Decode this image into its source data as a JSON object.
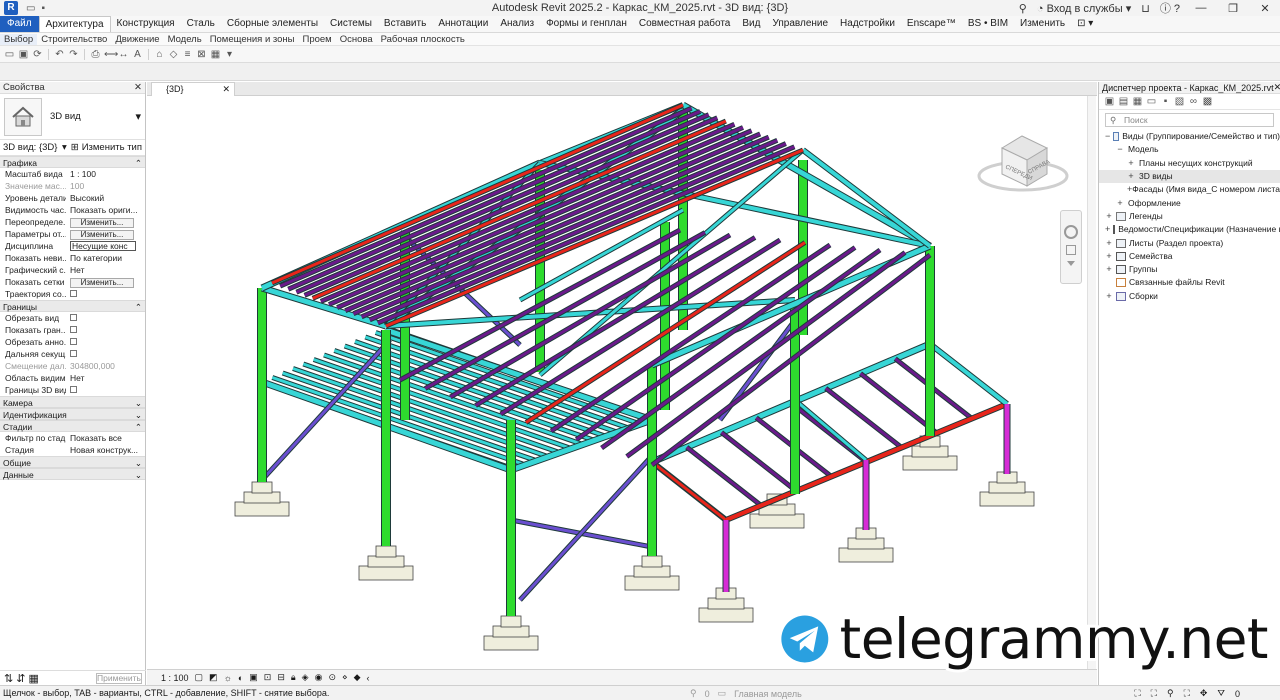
{
  "window": {
    "app_logo": "R",
    "title": "Autodesk Revit 2025.2 - Каркас_КМ_2025.rvt - 3D вид: {3D}",
    "sign_in": "Вход в службы",
    "help": "?"
  },
  "ribbon": {
    "tabs": [
      "Файл",
      "Архитектура",
      "Конструкция",
      "Сталь",
      "Сборные элементы",
      "Системы",
      "Вставить",
      "Аннотации",
      "Анализ",
      "Формы и генплан",
      "Совместная работа",
      "Вид",
      "Управление",
      "Надстройки",
      "Enscape™",
      "BS • BIM",
      "Изменить"
    ],
    "active_tab": "Архитектура",
    "panels": [
      "Выбор",
      "Строительство",
      "Движение",
      "Модель",
      "Помещения и зоны",
      "Проем",
      "Основа",
      "Рабочая плоскость"
    ]
  },
  "properties": {
    "title": "Свойства",
    "type_name": "3D вид",
    "instance_selector": "3D вид: {3D}",
    "edit_type": "Изменить тип",
    "groups": [
      {
        "name": "Графика",
        "rows": [
          {
            "key": "Масштаб вида",
            "value": "1 : 100",
            "kind": "text"
          },
          {
            "key": "Значение мас...",
            "value": "100",
            "kind": "grey"
          },
          {
            "key": "Уровень детали...",
            "value": "Высокий",
            "kind": "text"
          },
          {
            "key": "Видимость час...",
            "value": "Показать ориги...",
            "kind": "text"
          },
          {
            "key": "Переопределе...",
            "value": "Изменить...",
            "kind": "button"
          },
          {
            "key": "Параметры от...",
            "value": "Изменить...",
            "kind": "button"
          },
          {
            "key": "Дисциплина",
            "value": "Несущие конс",
            "kind": "boxed"
          },
          {
            "key": "Показать неви...",
            "value": "По категории",
            "kind": "text"
          },
          {
            "key": "Графический с...",
            "value": "Нет",
            "kind": "text"
          },
          {
            "key": "Показать сетки",
            "value": "Изменить...",
            "kind": "button"
          },
          {
            "key": "Траектория со...",
            "value": "",
            "kind": "check"
          }
        ]
      },
      {
        "name": "Границы",
        "rows": [
          {
            "key": "Обрезать вид",
            "value": "",
            "kind": "check"
          },
          {
            "key": "Показать гран...",
            "value": "",
            "kind": "check"
          },
          {
            "key": "Обрезать анно...",
            "value": "",
            "kind": "check"
          },
          {
            "key": "Дальняя секущ...",
            "value": "",
            "kind": "check"
          },
          {
            "key": "Смещение дал...",
            "value": "304800,000",
            "kind": "grey"
          },
          {
            "key": "Область видим...",
            "value": "Нет",
            "kind": "text"
          },
          {
            "key": "Границы 3D вида",
            "value": "",
            "kind": "check"
          }
        ]
      },
      {
        "name": "Камера",
        "rows": []
      },
      {
        "name": "Идентификация",
        "rows": []
      },
      {
        "name": "Стадии",
        "rows": [
          {
            "key": "Фильтр по стад...",
            "value": "Показать все",
            "kind": "text"
          },
          {
            "key": "Стадия",
            "value": "Новая конструк...",
            "kind": "text"
          }
        ]
      },
      {
        "name": "Общие",
        "rows": []
      },
      {
        "name": "Данные",
        "rows": []
      }
    ],
    "apply": "Применить"
  },
  "view": {
    "tab_label": "{3D}",
    "scale": "1 : 100",
    "viewcube_labels": [
      "СПЕРЕДИ",
      "СПРАВА"
    ]
  },
  "browser": {
    "title": "Диспетчер проекта - Каркас_КМ_2025.rvt",
    "search_placeholder": "Поиск",
    "tree": [
      {
        "level": 0,
        "twisty": "−",
        "icon": "views",
        "label": "Виды (Группирование/Семейство и тип)"
      },
      {
        "level": 1,
        "twisty": "−",
        "icon": "",
        "label": "Модель"
      },
      {
        "level": 2,
        "twisty": "+",
        "icon": "",
        "label": "Планы несущих конструкций"
      },
      {
        "level": 2,
        "twisty": "+",
        "icon": "",
        "label": "3D виды",
        "selected": true
      },
      {
        "level": 2,
        "twisty": "+",
        "icon": "",
        "label": "Фасады (Имя вида_С номером листа)"
      },
      {
        "level": 1,
        "twisty": "+",
        "icon": "",
        "label": "Оформление"
      },
      {
        "level": 0,
        "twisty": "+",
        "icon": "legend",
        "label": "Легенды"
      },
      {
        "level": 0,
        "twisty": "+",
        "icon": "schedule",
        "label": "Ведомости/Спецификации (Назначение в"
      },
      {
        "level": 0,
        "twisty": "+",
        "icon": "sheet",
        "label": "Листы (Раздел проекта)"
      },
      {
        "level": 0,
        "twisty": "+",
        "icon": "family",
        "label": "Семейства"
      },
      {
        "level": 0,
        "twisty": "+",
        "icon": "group",
        "label": "Группы"
      },
      {
        "level": 0,
        "twisty": "",
        "icon": "link",
        "label": "Связанные файлы Revit"
      },
      {
        "level": 0,
        "twisty": "+",
        "icon": "assembly",
        "label": "Сборки"
      }
    ]
  },
  "status": {
    "hint": "Щелчок - выбор, TAB - варианты, CTRL - добавление, SHIFT - снятие выбора.",
    "counter": "0",
    "model": "Главная модель",
    "filter_count": "0"
  },
  "watermark": {
    "text": "telegrammy.net"
  },
  "colors": {
    "column": "#2edb2e",
    "beam": "#37d6d6",
    "purlin": "#6a1a8a",
    "ridge": "#e8251b",
    "brace": "#6a4fd0",
    "post": "#d62bd6",
    "footing": "#efeedd"
  }
}
